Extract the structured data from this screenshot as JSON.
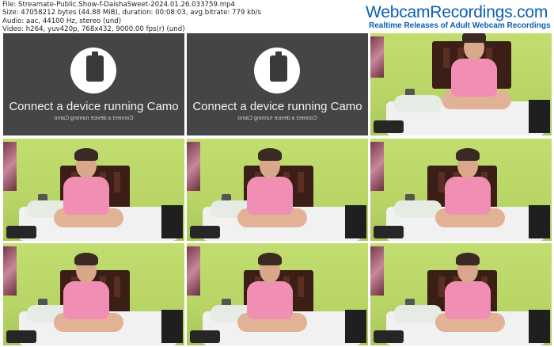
{
  "info": {
    "file": "File: Streamate-Public.Show-f-DaishaSweet-2024.01.26.033759.mp4",
    "size": "Size: 47058212 bytes (44.88 MiB), duration: 00:08:03, avg.bitrate: 779 kb/s",
    "audio": "Audio: aac, 44100 Hz, stereo (und)",
    "video": "Video: h264, yuv420p, 768x432, 9000.00 fps(r) (und)"
  },
  "logo": {
    "brand": "WebcamRecordings.com",
    "tagline": "Realtime Releases of Adult Webcam Recordings"
  },
  "placeholder": {
    "title": "Connect a device running Camo",
    "subtitle": "Connect a device running Camo",
    "icon": "phone-device-icon"
  },
  "thumbnails": [
    {
      "kind": "placeholder"
    },
    {
      "kind": "placeholder"
    },
    {
      "kind": "webcam"
    },
    {
      "kind": "webcam"
    },
    {
      "kind": "webcam"
    },
    {
      "kind": "webcam"
    },
    {
      "kind": "webcam"
    },
    {
      "kind": "webcam"
    },
    {
      "kind": "webcam"
    }
  ],
  "colors": {
    "brand": "#0a5fb4",
    "placeholder_bg": "#444546",
    "wall": "#b9d86a",
    "shirt": "#f08fb3"
  }
}
